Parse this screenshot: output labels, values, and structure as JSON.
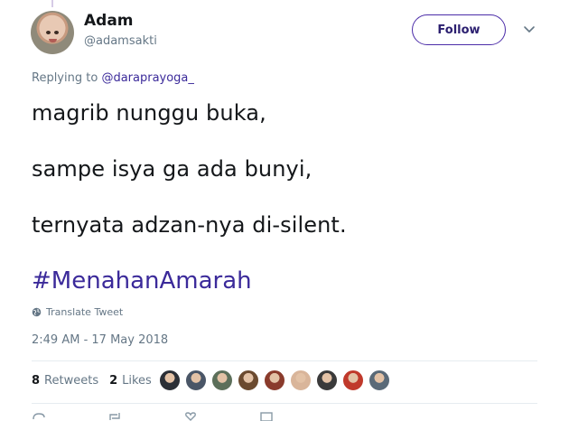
{
  "tweet": {
    "author": {
      "display_name": "Adam",
      "screen_name": "@adamsakti"
    },
    "follow_label": "Follow",
    "replying_to": {
      "prefix": "Replying to",
      "handle": "@daraprayoga_"
    },
    "lines": [
      "magrib nunggu buka,",
      "sampe isya ga ada bunyi,",
      "ternyata adzan-nya di-silent."
    ],
    "hashtag": "#MenahanAmarah",
    "translate_label": "Translate Tweet",
    "timestamp": "2:49 AM - 17 May 2018",
    "stats": {
      "retweets_count": "8",
      "retweets_label": "Retweets",
      "likes_count": "2",
      "likes_label": "Likes"
    },
    "likers": [
      {
        "name": "liker-avatar",
        "color": "#2b2f36"
      },
      {
        "name": "liker-avatar",
        "color": "#4a5667"
      },
      {
        "name": "liker-avatar",
        "color": "#5c6f5a"
      },
      {
        "name": "liker-avatar",
        "color": "#6b4a2f"
      },
      {
        "name": "liker-avatar",
        "color": "#8a3b2c"
      },
      {
        "name": "liker-avatar",
        "color": "#d9b59a"
      },
      {
        "name": "liker-avatar",
        "color": "#3a3a3a"
      },
      {
        "name": "liker-avatar",
        "color": "#c0392b"
      },
      {
        "name": "liker-avatar",
        "color": "#5a6a78"
      }
    ]
  },
  "icons": {
    "chevron": "chevron-down-icon",
    "globe": "globe-icon",
    "reply": "reply-icon",
    "retweet": "retweet-icon",
    "like": "heart-icon",
    "message": "message-icon"
  },
  "colors": {
    "accent": "#3b2a9a",
    "follow_border": "#4b2ca8",
    "muted": "#657786",
    "text": "#14171a"
  }
}
